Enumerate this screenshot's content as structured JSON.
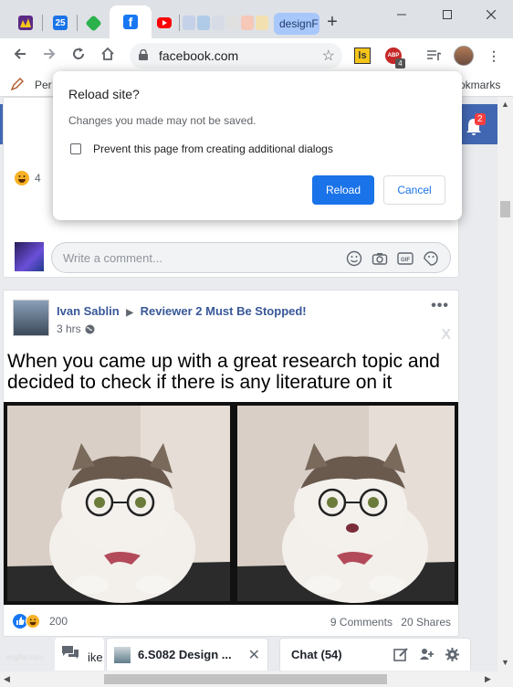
{
  "browser": {
    "url": "facebook.com",
    "tabs": [
      {
        "icon": "purple-app-icon",
        "color": "#6a1b9a"
      },
      {
        "icon": "calendar-icon",
        "label": "25",
        "color": "#1a73e8"
      },
      {
        "icon": "feedly-icon",
        "color": "#2bb24c"
      },
      {
        "icon": "facebook-icon",
        "label": "f",
        "color": "#1877f2"
      },
      {
        "icon": "youtube-icon",
        "color": "#ff0000"
      }
    ],
    "design_tab_label": "designF",
    "new_tab_symbol": "+",
    "bookmarks_left": "Per",
    "bookmarks_right": "okmarks",
    "extension_ls_label": "ls",
    "extension_abp_label": "ABP",
    "extension_abp_count": "4"
  },
  "facebook": {
    "logo": "f",
    "search_stub": "S",
    "notifications_count": "2",
    "prev_post": {
      "reaction_count": "4",
      "comment_placeholder": "Write a comment..."
    },
    "post": {
      "author": "Ivan Sablin",
      "group": "Reviewer 2 Must Be Stopped!",
      "time": "3 hrs",
      "more": "•••",
      "close": "X",
      "caption": "When you came up with a great research topic and decided to check if there is any literature on it",
      "watermark": "imgflip.com",
      "reaction_count": "200",
      "comments": "9 Comments",
      "shares": "20 Shares"
    },
    "chat_tab": {
      "label": "6.S082 Design ...",
      "partial": "ike"
    },
    "chat": {
      "label": "Chat (54)"
    }
  },
  "dialog": {
    "title": "Reload site?",
    "message": "Changes you made may not be saved.",
    "checkbox_label": "Prevent this page from creating additional dialogs",
    "reload_label": "Reload",
    "cancel_label": "Cancel"
  },
  "colors": {
    "facebook_blue": "#4267b2",
    "chrome_accent": "#1a73e8"
  }
}
